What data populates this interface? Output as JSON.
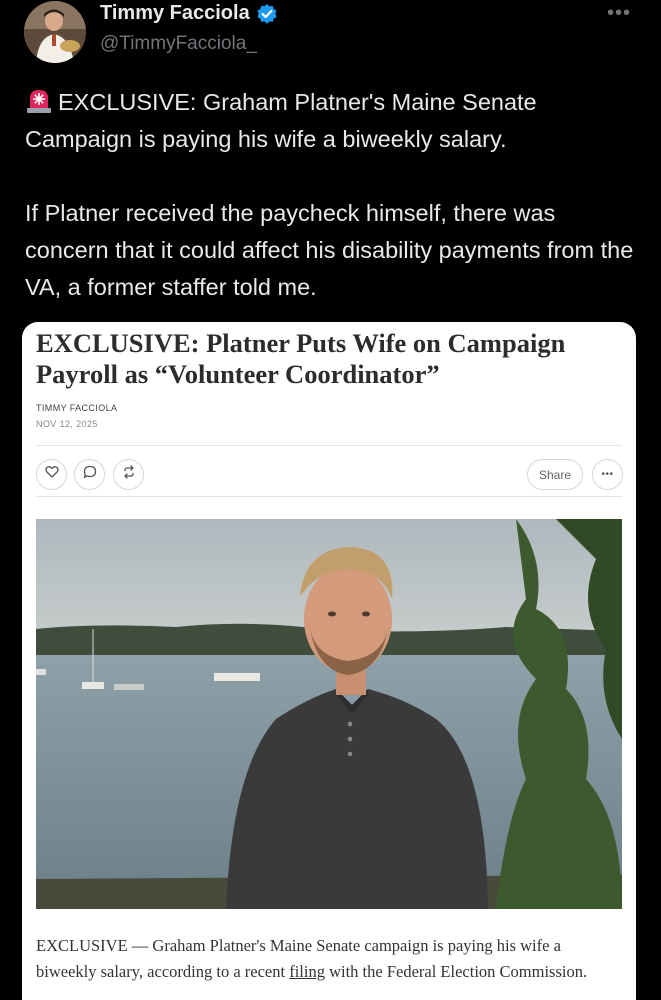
{
  "author": {
    "name": "Timmy Facciola",
    "handle": "@TimmyFacciola_",
    "verified": true,
    "more_label": "•••"
  },
  "tweet": {
    "line1_icon": "police-siren-emoji",
    "paragraph1": "EXCLUSIVE: Graham Platner's Maine Senate Campaign is paying his wife a biweekly salary.",
    "paragraph2": "If Platner received the paycheck himself, there was concern that it could affect his disability payments from the VA, a former staffer told me."
  },
  "article": {
    "headline": "EXCLUSIVE: Platner Puts Wife on Campaign Payroll as “Volunteer Coordinator”",
    "byline": "TIMMY FACCIOLA",
    "date": "NOV 12, 2025",
    "share_label": "Share",
    "more_label": "•••",
    "icons": [
      "heart-icon",
      "comment-icon",
      "restack-icon"
    ],
    "caption_before_link": "EXCLUSIVE — Graham Platner's Maine Senate campaign is paying his wife a biweekly salary, according to a recent ",
    "caption_link": "filing",
    "caption_after_link": " with the Federal Election Commission."
  },
  "colors": {
    "background": "#000000",
    "text": "#e7e9ea",
    "secondary_text": "#71767b",
    "verified_badge": "#1d9bf0",
    "card_bg": "#ffffff"
  }
}
